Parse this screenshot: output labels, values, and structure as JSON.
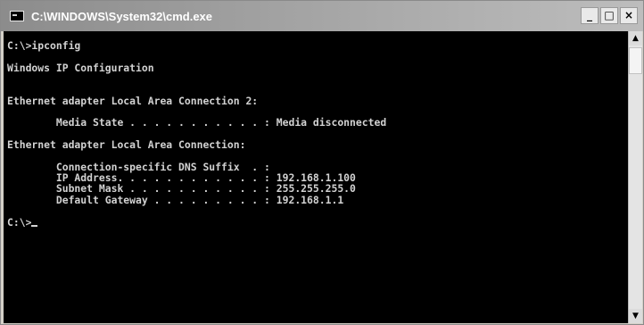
{
  "window": {
    "title": "C:\\WINDOWS\\System32\\cmd.exe",
    "icon": "console-icon",
    "controls": {
      "minimize": "_",
      "maximize": "□",
      "close": "×"
    }
  },
  "console": {
    "lines": [
      "C:\\>ipconfig",
      "",
      "Windows IP Configuration",
      "",
      "",
      "Ethernet adapter Local Area Connection 2:",
      "",
      "        Media State . . . . . . . . . . . : Media disconnected",
      "",
      "Ethernet adapter Local Area Connection:",
      "",
      "        Connection-specific DNS Suffix  . :",
      "        IP Address. . . . . . . . . . . . : 192.168.1.100",
      "        Subnet Mask . . . . . . . . . . . : 255.255.255.0",
      "        Default Gateway . . . . . . . . . : 192.168.1.1",
      "",
      "C:\\>"
    ]
  },
  "scrollbar": {
    "up_arrow": "▲",
    "down_arrow": "▼"
  }
}
